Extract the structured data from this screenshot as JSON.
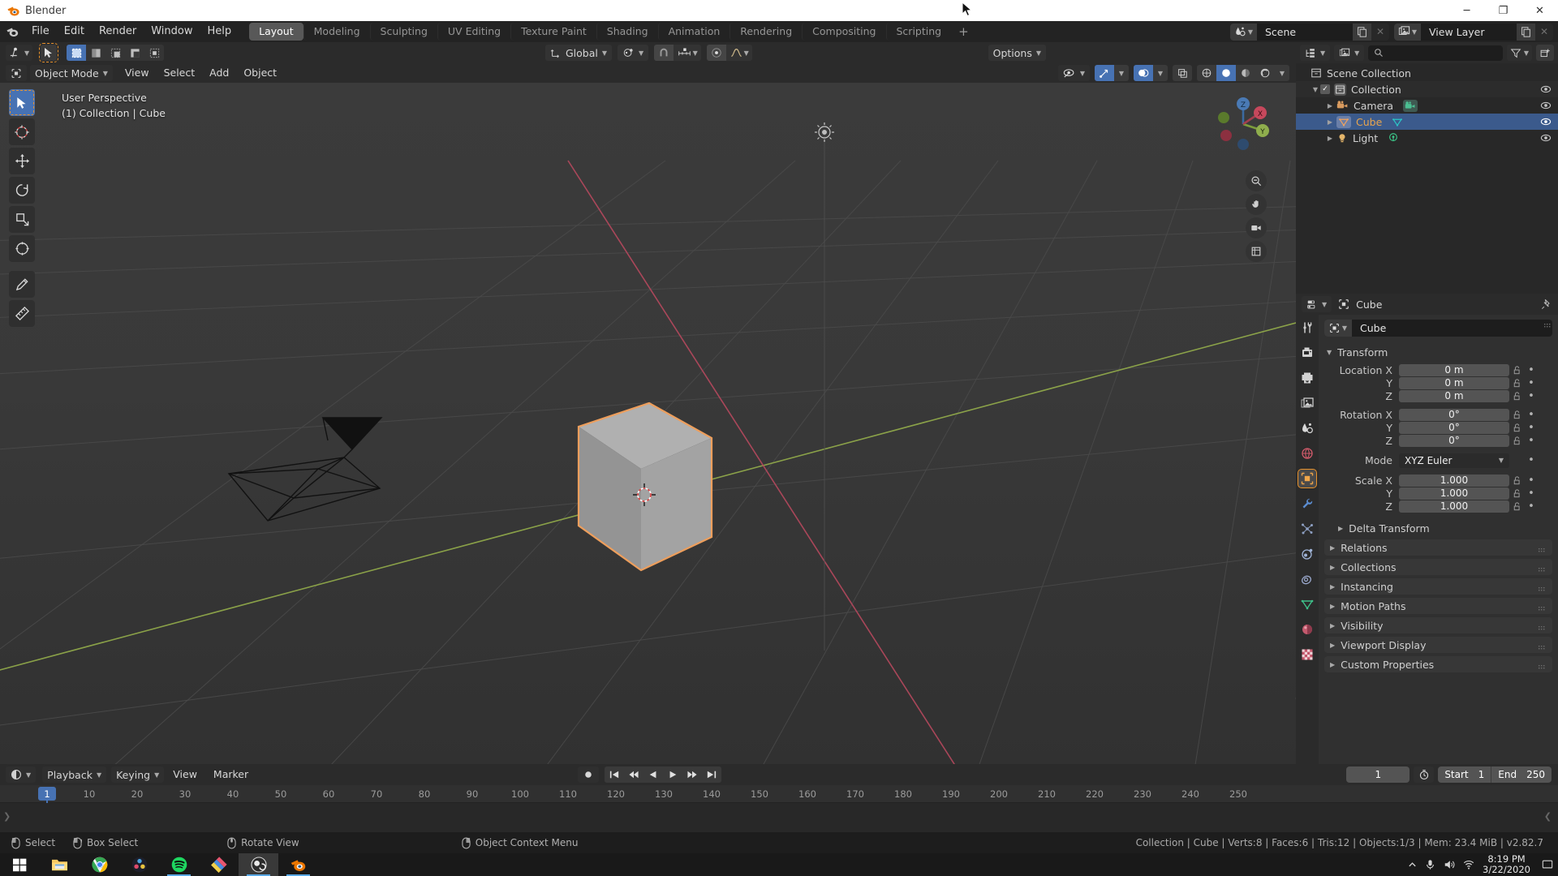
{
  "window": {
    "title": "Blender",
    "controls": [
      "minimize",
      "maximize",
      "close"
    ],
    "minimize_glyph": "─",
    "maximize_glyph": "❐",
    "close_glyph": "✕"
  },
  "topbar": {
    "menus": [
      "File",
      "Edit",
      "Render",
      "Window",
      "Help"
    ],
    "tabs": [
      {
        "label": "Layout",
        "active": true
      },
      {
        "label": "Modeling",
        "active": false
      },
      {
        "label": "Sculpting",
        "active": false
      },
      {
        "label": "UV Editing",
        "active": false
      },
      {
        "label": "Texture Paint",
        "active": false
      },
      {
        "label": "Shading",
        "active": false
      },
      {
        "label": "Animation",
        "active": false
      },
      {
        "label": "Rendering",
        "active": false
      },
      {
        "label": "Compositing",
        "active": false
      },
      {
        "label": "Scripting",
        "active": false
      }
    ],
    "add_workspace": "+",
    "scene": {
      "label": "Scene",
      "icon": "scene-icon"
    },
    "view_layer": {
      "label": "View Layer",
      "icon": "view-layer-icon"
    }
  },
  "viewport_header": {
    "editor_type_icon": "editor-type-icon",
    "mode": "Object Mode",
    "menus": [
      "View",
      "Select",
      "Add",
      "Object"
    ],
    "transform_orientation": "Global",
    "pivot_icon": "pivot-point-icon",
    "snap_icon": "snap-magnet-icon",
    "snap_to": "snap-increment-icon",
    "proportional_icon": "proportional-edit-icon",
    "falloff_icon": "falloff-curve-icon",
    "options_label": "Options",
    "select_mode_icons": [
      "select-box-icon",
      "select-new-icon",
      "select-extend-icon",
      "select-subtract-icon",
      "select-difference-icon"
    ],
    "cursor_tool_icon": "select-cursor-icon",
    "visibility_icon": "object-visibility-icon",
    "gizmo_icon": "gizmo-icon",
    "overlays_icon": "overlays-icon",
    "xray_icon": "xray-toggle-icon",
    "shading_modes": [
      "wireframe-shading-icon",
      "solid-shading-icon",
      "material-preview-icon",
      "rendered-shading-icon"
    ]
  },
  "viewport": {
    "perspective_label": "User Perspective",
    "scene_label": "(1) Collection | Cube",
    "tools": [
      "tweak-select-tool",
      "cursor-tool",
      "move-tool",
      "rotate-tool",
      "scale-tool",
      "transform-tool",
      "annotate-tool",
      "measure-tool"
    ],
    "nav_gizmo": {
      "x": "X",
      "y": "Y",
      "z": "Z"
    },
    "side_buttons": [
      "zoom-icon",
      "pan-hand-icon",
      "camera-view-icon",
      "toggle-ortho-icon"
    ]
  },
  "outliner": {
    "display_mode_icon": "outliner-display-mode-icon",
    "filter_id_icon": "outliner-id-filter-icon",
    "search_placeholder": "",
    "filter_icon": "funnel-filter-icon",
    "new_collection_icon": "new-collection-icon",
    "rows": [
      {
        "label": "Scene Collection",
        "icon": "collection-icon",
        "indent": 0,
        "selected": false,
        "expand": "",
        "checkbox": false,
        "eye": false
      },
      {
        "label": "Collection",
        "icon": "collection-icon",
        "indent": 1,
        "selected": false,
        "expand": "▼",
        "checkbox": true,
        "eye": true
      },
      {
        "label": "Camera",
        "icon": "camera-object-icon",
        "indent": 2,
        "selected": false,
        "expand": "▶",
        "checkbox": false,
        "eye": true,
        "data_icon": "camera-data-icon"
      },
      {
        "label": "Cube",
        "icon": "mesh-object-icon",
        "indent": 2,
        "selected": true,
        "expand": "▶",
        "checkbox": false,
        "eye": true,
        "data_icon": "mesh-data-icon"
      },
      {
        "label": "Light",
        "icon": "light-object-icon",
        "indent": 2,
        "selected": false,
        "expand": "▶",
        "checkbox": false,
        "eye": true,
        "data_icon": "light-data-icon"
      }
    ]
  },
  "properties": {
    "editor_icon": "properties-editor-icon",
    "breadcrumb": "Cube",
    "breadcrumb_icon": "object-properties-icon",
    "pin_icon": "pin-icon",
    "object_name": "Cube",
    "tabs": [
      {
        "name": "tool-tab",
        "on": false
      },
      {
        "name": "render-tab",
        "on": false
      },
      {
        "name": "output-tab",
        "on": false
      },
      {
        "name": "view-layer-tab",
        "on": false
      },
      {
        "name": "scene-tab",
        "on": false
      },
      {
        "name": "world-tab",
        "on": false
      },
      {
        "name": "object-tab",
        "on": true
      },
      {
        "name": "modifier-tab",
        "on": false
      },
      {
        "name": "particles-tab",
        "on": false
      },
      {
        "name": "physics-tab",
        "on": false
      },
      {
        "name": "constraints-tab",
        "on": false
      },
      {
        "name": "data-tab",
        "on": false
      },
      {
        "name": "material-tab",
        "on": false
      },
      {
        "name": "texture-tab",
        "on": false
      }
    ],
    "transform": {
      "title": "Transform",
      "rows": [
        {
          "label": "Location X",
          "value": "0 m"
        },
        {
          "label": "Y",
          "value": "0 m"
        },
        {
          "label": "Z",
          "value": "0 m"
        },
        {
          "label": "Rotation X",
          "value": "0°"
        },
        {
          "label": "Y",
          "value": "0°"
        },
        {
          "label": "Z",
          "value": "0°"
        }
      ],
      "mode_label": "Mode",
      "mode_value": "XYZ Euler",
      "scale_rows": [
        {
          "label": "Scale X",
          "value": "1.000"
        },
        {
          "label": "Y",
          "value": "1.000"
        },
        {
          "label": "Z",
          "value": "1.000"
        }
      ]
    },
    "collapsed_panels": [
      {
        "label": "Delta Transform",
        "sub": true
      },
      {
        "label": "Relations",
        "sub": false
      },
      {
        "label": "Collections",
        "sub": false
      },
      {
        "label": "Instancing",
        "sub": false
      },
      {
        "label": "Motion Paths",
        "sub": false
      },
      {
        "label": "Visibility",
        "sub": false
      },
      {
        "label": "Viewport Display",
        "sub": false
      },
      {
        "label": "Custom Properties",
        "sub": false
      }
    ]
  },
  "timeline": {
    "editor_icon": "timeline-editor-icon",
    "menus": [
      "Playback",
      "Keying",
      "View",
      "Marker"
    ],
    "record_icon": "auto-keying-icon",
    "transport": [
      "jump-to-start",
      "jump-prev-keyframe",
      "play-reverse",
      "play",
      "jump-next-keyframe",
      "jump-to-end"
    ],
    "current_frame": "1",
    "frame_clock_icon": "use-preview-range-icon",
    "start_label": "Start",
    "start_value": "1",
    "end_label": "End",
    "end_value": "250",
    "ticks": [
      1,
      10,
      20,
      30,
      40,
      50,
      60,
      70,
      80,
      90,
      100,
      110,
      120,
      130,
      140,
      150,
      160,
      170,
      180,
      190,
      200,
      210,
      220,
      230,
      240,
      250
    ],
    "playhead_frame": 1
  },
  "statusbar": {
    "hints": [
      {
        "icon": "mouse-left-icon",
        "label": "Select"
      },
      {
        "icon": "mouse-left-drag-icon",
        "label": "Box Select"
      },
      {
        "icon": "mouse-middle-icon",
        "label": "Rotate View"
      },
      {
        "icon": "mouse-right-icon",
        "label": "Object Context Menu"
      }
    ],
    "info": "Collection | Cube | Verts:8 | Faces:6 | Tris:12 | Objects:1/3 | Mem: 23.4 MiB | v2.82.7"
  },
  "taskbar": {
    "items": [
      {
        "name": "start-button",
        "active": false,
        "underline": false
      },
      {
        "name": "file-explorer-icon",
        "active": false,
        "underline": false
      },
      {
        "name": "chrome-icon",
        "active": false,
        "underline": false
      },
      {
        "name": "davinci-resolve-icon",
        "active": false,
        "underline": false
      },
      {
        "name": "spotify-icon",
        "active": false,
        "underline": true
      },
      {
        "name": "paint-net-icon",
        "active": false,
        "underline": false
      },
      {
        "name": "obs-studio-icon",
        "active": true,
        "underline": true
      },
      {
        "name": "blender-taskbar-icon",
        "active": false,
        "underline": true
      }
    ],
    "tray": [
      "show-hidden-icons",
      "microphone-icon",
      "volume-icon",
      "network-icon"
    ],
    "time": "8:19 PM",
    "date": "3/22/2020",
    "notification_icon": "action-center-icon"
  },
  "colors": {
    "accent_blue": "#4772b3",
    "accent_orange": "#e8922c",
    "selected_outline": "#ed9e5c",
    "panel_bg": "#303030",
    "header_bg": "#2b2b2b"
  }
}
